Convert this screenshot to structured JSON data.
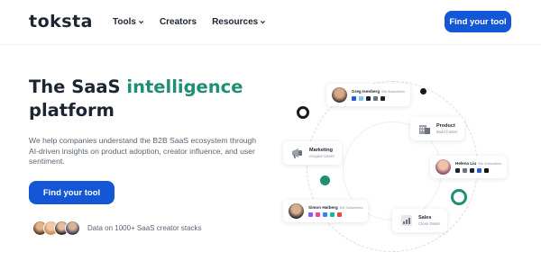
{
  "brand": {
    "logo_text": "toksta",
    "accent": "#1f8f73",
    "primary": "#1457d6"
  },
  "nav": {
    "items": [
      {
        "label": "Tools",
        "has_dropdown": true
      },
      {
        "label": "Creators",
        "has_dropdown": false
      },
      {
        "label": "Resources",
        "has_dropdown": true
      }
    ],
    "cta_label": "Find your tool"
  },
  "hero": {
    "title_part1": "The SaaS ",
    "title_accent": "intelligence",
    "title_part2": "platform",
    "description": "We help companies understand the B2B SaaS ecosystem through AI-driven insights on product adoption, creator influence, and user sentiment.",
    "cta_label": "Find your tool",
    "proof_text": "Data on 1000+ SaaS creator stacks"
  },
  "diagram": {
    "people": [
      {
        "name": "Greg Isenberg",
        "subscribers": "93k Subscribers"
      },
      {
        "name": "Helena Liu",
        "subscribers": "54k Subscribers"
      },
      {
        "name": "Simon Høiberg",
        "subscribers": "60k Subscribers"
      }
    ],
    "categories": [
      {
        "title": "Product",
        "subtitle": "Build Faster",
        "icon": "buildings-icon"
      },
      {
        "title": "Marketing",
        "subtitle": "Acquire Users",
        "icon": "megaphone-icon"
      },
      {
        "title": "Sales",
        "subtitle": "Close Deals",
        "icon": "sales-chart-icon"
      }
    ]
  }
}
